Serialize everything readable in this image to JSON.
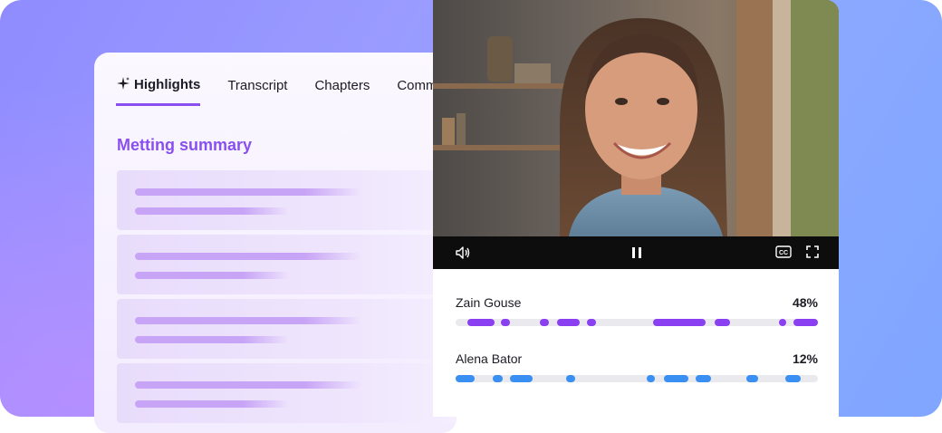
{
  "tabs": [
    {
      "label": "Highlights",
      "icon": "sparkle-icon",
      "active": true
    },
    {
      "label": "Transcript",
      "active": false
    },
    {
      "label": "Chapters",
      "active": false
    },
    {
      "label": "Comm",
      "active": false
    }
  ],
  "summary": {
    "title": "Metting summary",
    "card_count": 4
  },
  "player": {
    "controls": {
      "volume_icon": "speaker-icon",
      "play_state_icon": "pause-icon",
      "captions_label": "CC",
      "fullscreen_icon": "fullscreen-icon"
    }
  },
  "speakers": [
    {
      "name": "Zain Gouse",
      "percent": "48%",
      "color": "#8a3ff0"
    },
    {
      "name": "Alena Bator",
      "percent": "12%",
      "color": "#3a8ff2"
    }
  ],
  "colors": {
    "accent": "#8a4ff0",
    "speaker_one": "#8a3ff0",
    "speaker_two": "#3a8ff2",
    "track": "#e9e9ee"
  }
}
